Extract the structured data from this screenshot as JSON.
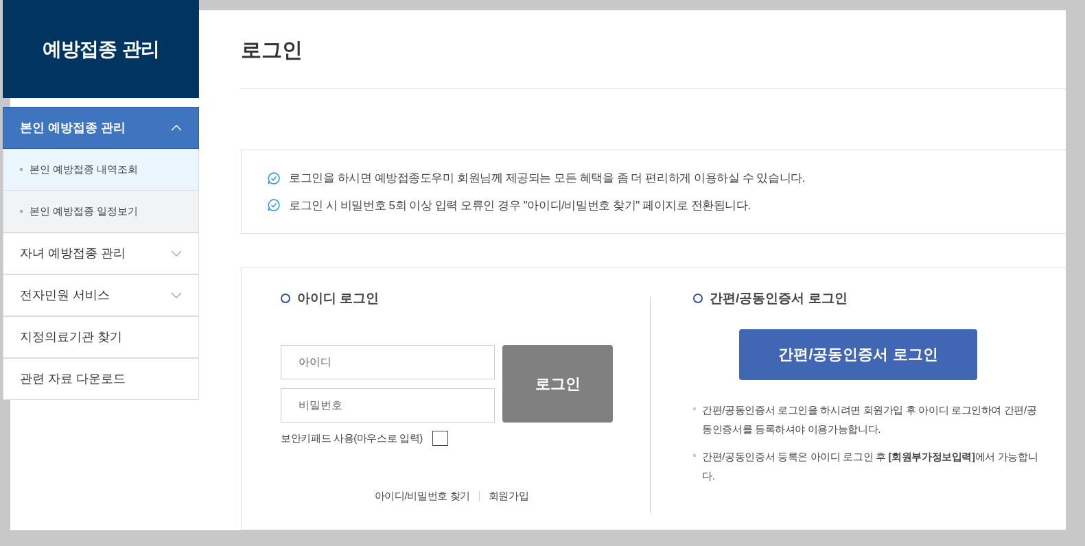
{
  "sidebar": {
    "title": "예방접종 관리",
    "items": [
      {
        "label": "본인 예방접종 관리",
        "kind": "group",
        "expanded": true,
        "children": [
          {
            "label": "본인 예방접종 내역조회",
            "selected": true
          },
          {
            "label": "본인 예방접종 일정보기",
            "selected": false
          }
        ]
      },
      {
        "label": "자녀 예방접종 관리",
        "kind": "group",
        "expanded": false
      },
      {
        "label": "전자민원 서비스",
        "kind": "group",
        "expanded": false
      },
      {
        "label": "지정의료기관 찾기",
        "kind": "link"
      },
      {
        "label": "관련 자료 다운로드",
        "kind": "link"
      }
    ]
  },
  "page_title": "로그인",
  "notices": [
    "로그인을 하시면 예방접종도우미 회원님께 제공되는 모든 혜택을 좀 더 편리하게 이용하실 수 있습니다.",
    "로그인 시 비밀번호 5회 이상 입력 오류인 경우 \"아이디/비밀번호 찾기\" 페이지로 전환됩니다."
  ],
  "id_login": {
    "heading": "아이디 로그인",
    "id_field": {
      "placeholder": "아이디"
    },
    "password_field": {
      "placeholder": "비밀번호"
    },
    "login_button": "로그인",
    "keypad": {
      "label": "보안키패드 사용(마우스로 입력)",
      "checked": false
    },
    "links": [
      "아이디/비밀번호 찾기",
      "회원가입"
    ]
  },
  "cert_login": {
    "heading": "간편/공동인증서 로그인",
    "button": "간편/공동인증서 로그인",
    "notes": [
      "간편/공동인증서 로그인을 하시려면 회원가입 후 아이디 로그인하여 간편/공동인증서를 등록하셔야 이용가능합니다.",
      "간편/공동인증서 등록은 아이디 로그인 후 **[회원부가정보입력]**에서 가능합니다."
    ]
  }
}
